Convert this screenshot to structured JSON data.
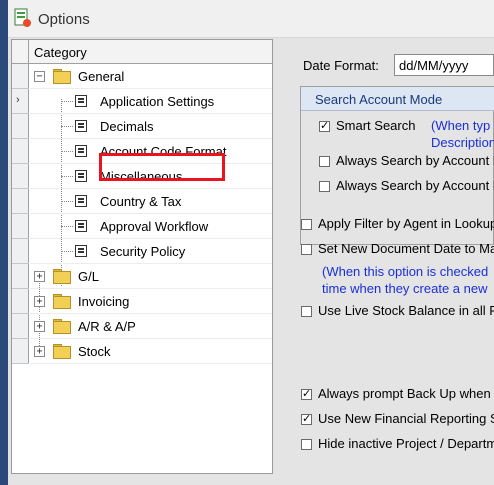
{
  "window": {
    "title": "Options",
    "accent": "#1a2fd8",
    "highlight_color": "#e8141e"
  },
  "tree": {
    "header": "Category",
    "general": {
      "label": "General",
      "expander": "−"
    },
    "general_children": [
      {
        "label": "Application Settings"
      },
      {
        "label": "Decimals"
      },
      {
        "label": "Account Code Format"
      },
      {
        "label": "Miscellaneous"
      },
      {
        "label": "Country & Tax"
      },
      {
        "label": "Approval Workflow"
      },
      {
        "label": "Security Policy"
      }
    ],
    "collapsed": [
      {
        "label": "G/L",
        "expander": "+"
      },
      {
        "label": "Invoicing",
        "expander": "+"
      },
      {
        "label": "A/R & A/P",
        "expander": "+"
      },
      {
        "label": "Stock",
        "expander": "+"
      }
    ],
    "row_arrow": "›"
  },
  "settings": {
    "date_format_label": "Date Format:",
    "date_format_value": "dd/MM/yyyy",
    "search_group": {
      "title": "Search Account Mode",
      "smart_search": {
        "label": "Smart Search",
        "checked": true,
        "note_line1": "(When typ",
        "note_line2": "Description"
      },
      "always_search_1": {
        "label": "Always Search by Account N",
        "checked": false
      },
      "always_search_2": {
        "label": "Always Search by Account D",
        "checked": false
      }
    },
    "apply_filter": {
      "label": "Apply Filter by Agent in Lookup",
      "checked": false
    },
    "new_doc_date": {
      "label": "Set New Document Date to Max",
      "checked": false,
      "note_line1": "(When this option is checked",
      "note_line2": "time when they create a new"
    },
    "live_stock": {
      "label": "Use Live Stock Balance in all Fi",
      "checked": false
    },
    "prompt_backup": {
      "label": "Always prompt Back Up when e",
      "checked": true
    },
    "new_financial": {
      "label": "Use New Financial Reporting S",
      "checked": true
    },
    "hide_inactive": {
      "label": "Hide inactive Project / Departm",
      "checked": false
    }
  }
}
